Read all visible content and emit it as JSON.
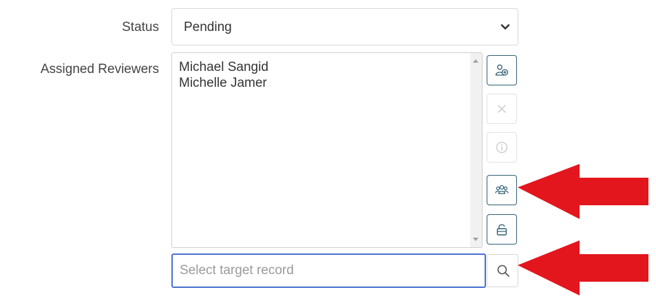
{
  "form": {
    "status_label": "Status",
    "status_value": "Pending",
    "reviewers_label": "Assigned Reviewers",
    "reviewers": [
      "Michael Sangid",
      "Michelle Jamer"
    ],
    "search_placeholder": "Select target record"
  },
  "icons": {
    "add_reviewer": "user-plus-icon",
    "remove": "close-icon",
    "info": "info-icon",
    "group": "users-group-icon",
    "unlock": "unlock-icon",
    "search": "search-icon",
    "select_chevron": "chevron-down-icon"
  },
  "colors": {
    "accent_border": "#2f5f73",
    "focus_border": "#4a6fd0",
    "annotation_arrow": "#e3161d"
  }
}
